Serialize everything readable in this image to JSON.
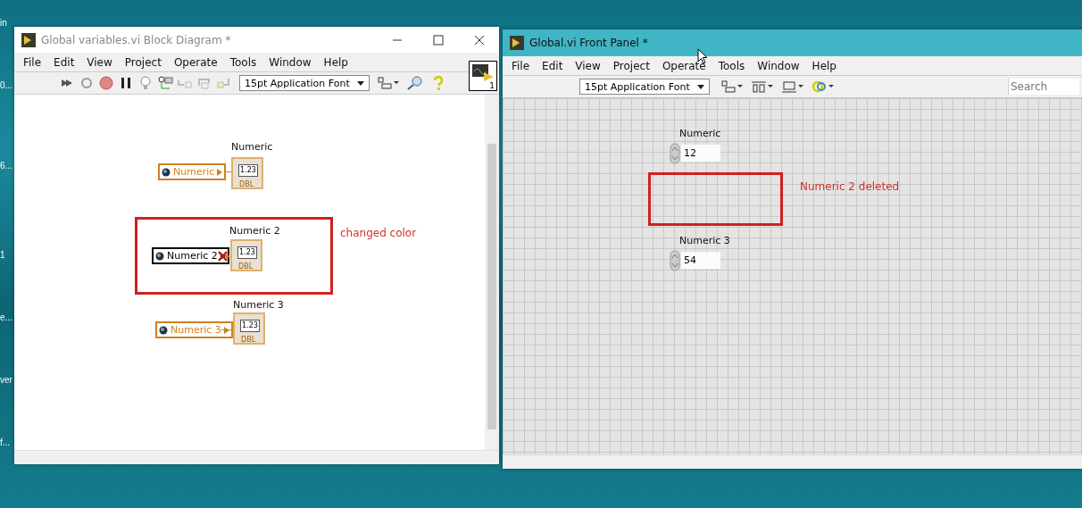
{
  "desktop": {
    "labels": [
      "in",
      "0...",
      "6...",
      "1",
      "e...",
      "ver",
      "f..."
    ]
  },
  "block_diagram": {
    "title": "Global variables.vi Block Diagram *",
    "menu": [
      "File",
      "Edit",
      "View",
      "Project",
      "Operate",
      "Tools",
      "Window",
      "Help"
    ],
    "font_selector": "15pt Application Font",
    "connector_number": "1",
    "nodes": [
      {
        "label": "Numeric",
        "variable": "Numeric",
        "broken": false,
        "value": "1.23",
        "type": "DBL"
      },
      {
        "label": "Numeric 2",
        "variable": "Numeric 2",
        "broken": true,
        "value": "1.23",
        "type": "DBL"
      },
      {
        "label": "Numeric 3",
        "variable": "Numeric 3",
        "broken": false,
        "value": "1.23",
        "type": "DBL"
      }
    ],
    "annotation": "changed color"
  },
  "front_panel": {
    "title": "Global.vi Front Panel *",
    "menu": [
      "File",
      "Edit",
      "View",
      "Project",
      "Operate",
      "Tools",
      "Window",
      "Help"
    ],
    "font_selector": "15pt Application Font",
    "search": {
      "placeholder": "Search"
    },
    "controls": [
      {
        "label": "Numeric",
        "value": "12"
      },
      {
        "label": "Numeric 3",
        "value": "54"
      }
    ],
    "annotation": "Numeric 2 deleted"
  }
}
